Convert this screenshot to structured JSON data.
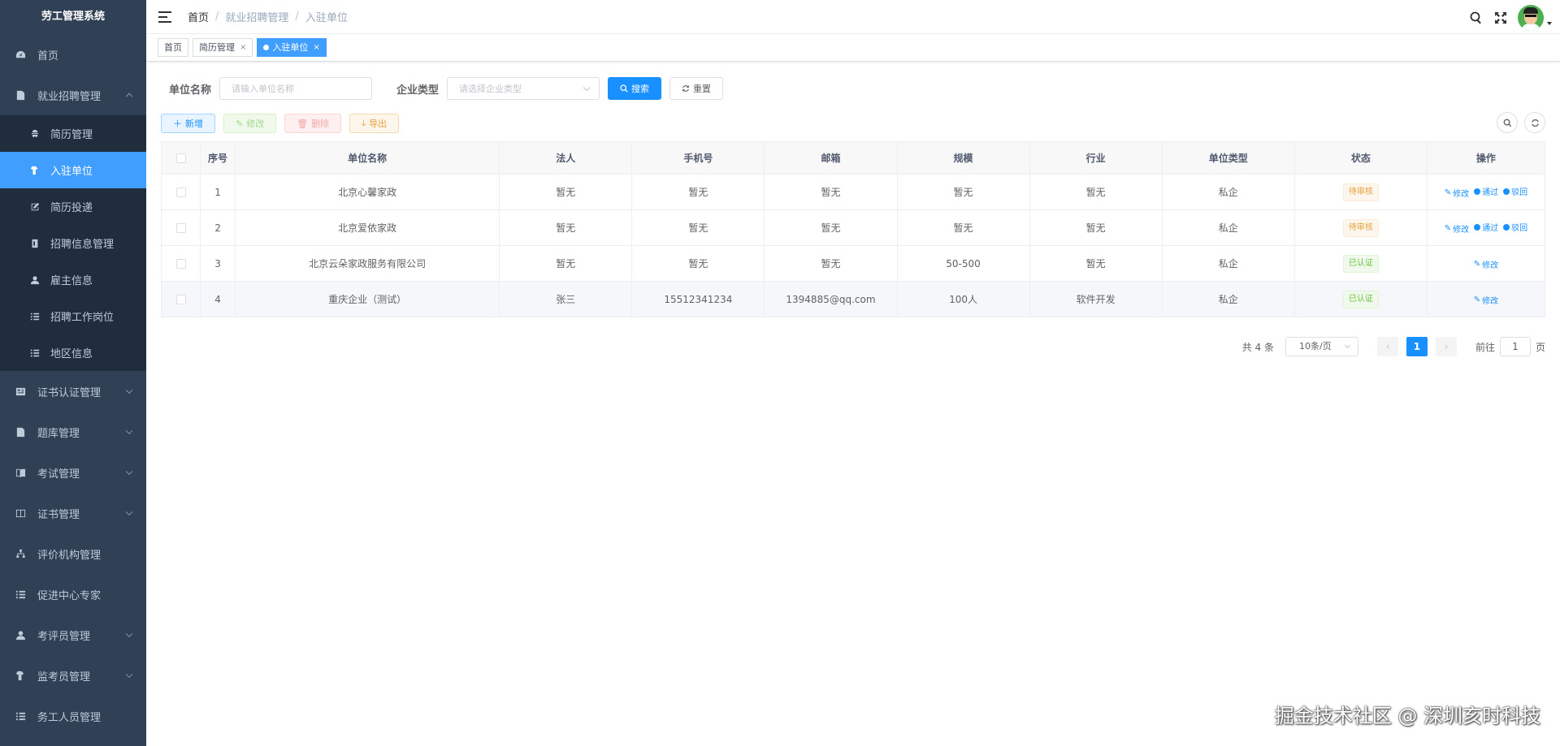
{
  "app": {
    "title": "劳工管理系统"
  },
  "sidebar": {
    "items": [
      {
        "label": "首页",
        "icon": "dashboard-icon",
        "expandable": false
      },
      {
        "label": "就业招聘管理",
        "icon": "document-icon",
        "expandable": true,
        "expanded": true,
        "children": [
          {
            "label": "简历管理",
            "icon": "people-icon"
          },
          {
            "label": "入驻单位",
            "icon": "build-icon",
            "active": true
          },
          {
            "label": "简历投递",
            "icon": "edit-icon"
          },
          {
            "label": "招聘信息管理",
            "icon": "card-icon"
          },
          {
            "label": "雇主信息",
            "icon": "user-icon"
          },
          {
            "label": "招聘工作岗位",
            "icon": "list-icon"
          },
          {
            "label": "地区信息",
            "icon": "list-icon"
          }
        ]
      },
      {
        "label": "证书认证管理",
        "icon": "form-icon",
        "expandable": true
      },
      {
        "label": "题库管理",
        "icon": "document-icon",
        "expandable": true
      },
      {
        "label": "考试管理",
        "icon": "book-icon",
        "expandable": true
      },
      {
        "label": "证书管理",
        "icon": "columns-icon",
        "expandable": true
      },
      {
        "label": "评价机构管理",
        "icon": "tree-icon",
        "expandable": false
      },
      {
        "label": "促进中心专家",
        "icon": "list-icon",
        "expandable": false
      },
      {
        "label": "考评员管理",
        "icon": "user-icon",
        "expandable": true
      },
      {
        "label": "监考员管理",
        "icon": "build-icon",
        "expandable": true
      },
      {
        "label": "务工人员管理",
        "icon": "list-icon",
        "expandable": false
      }
    ]
  },
  "breadcrumb": [
    "首页",
    "就业招聘管理",
    "入驻单位"
  ],
  "tags": [
    {
      "label": "首页",
      "closable": false,
      "active": false
    },
    {
      "label": "简历管理",
      "closable": true,
      "active": false
    },
    {
      "label": "入驻单位",
      "closable": true,
      "active": true
    }
  ],
  "search": {
    "name_label": "单位名称",
    "name_placeholder": "请输入单位名称",
    "type_label": "企业类型",
    "type_placeholder": "请选择企业类型",
    "search_btn": "搜索",
    "reset_btn": "重置"
  },
  "toolbar": {
    "add": "新增",
    "edit": "修改",
    "delete": "删除",
    "export": "导出"
  },
  "table": {
    "headers": [
      "序号",
      "单位名称",
      "法人",
      "手机号",
      "邮箱",
      "规模",
      "行业",
      "单位类型",
      "状态",
      "操作"
    ],
    "rows": [
      {
        "no": "1",
        "name": "北京心馨家政",
        "legal": "暂无",
        "phone": "暂无",
        "email": "暂无",
        "scale": "暂无",
        "industry": "暂无",
        "type": "私企",
        "status": "待审核",
        "status_kind": "pending"
      },
      {
        "no": "2",
        "name": "北京爱依家政",
        "legal": "暂无",
        "phone": "暂无",
        "email": "暂无",
        "scale": "暂无",
        "industry": "暂无",
        "type": "私企",
        "status": "待审核",
        "status_kind": "pending"
      },
      {
        "no": "3",
        "name": "北京云朵家政服务有限公司",
        "legal": "暂无",
        "phone": "暂无",
        "email": "暂无",
        "scale": "50-500",
        "industry": "暂无",
        "type": "私企",
        "status": "已认证",
        "status_kind": "ok"
      },
      {
        "no": "4",
        "name": "重庆企业（测试）",
        "legal": "张三",
        "phone": "15512341234",
        "email": "1394885@qq.com",
        "scale": "100人",
        "industry": "软件开发",
        "type": "私企",
        "status": "已认证",
        "status_kind": "ok"
      }
    ],
    "ops": {
      "edit": "修改",
      "pass": "通过",
      "reject": "驳回"
    }
  },
  "pagination": {
    "total": "共 4 条",
    "page_size": "10条/页",
    "current": "1",
    "goto_prefix": "前往",
    "goto_value": "1",
    "goto_suffix": "页"
  },
  "watermark": "掘金技术社区 @ 深圳亥时科技",
  "colors": {
    "sidebar_bg": "#304156",
    "submenu_bg": "#1f2d3d",
    "accent": "#1890ff",
    "active_menu": "#409eff"
  }
}
